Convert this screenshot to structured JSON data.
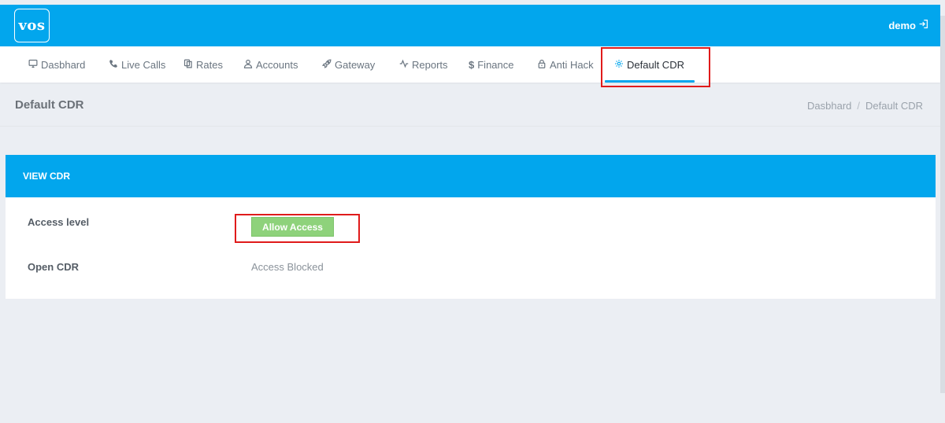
{
  "brand": {
    "logo_text": "vos"
  },
  "user": {
    "name": "demo"
  },
  "nav": {
    "items": [
      {
        "label": "Dasbhard",
        "icon": "monitor-icon"
      },
      {
        "label": "Live Calls",
        "icon": "phone-icon"
      },
      {
        "label": "Rates",
        "icon": "copy-icon"
      },
      {
        "label": "Accounts",
        "icon": "user-icon"
      },
      {
        "label": "Gateway",
        "icon": "rocket-icon"
      },
      {
        "label": "Reports",
        "icon": "activity-icon"
      },
      {
        "label": "Finance",
        "icon": "dollar-icon"
      },
      {
        "label": "Anti Hack",
        "icon": "lock-icon"
      },
      {
        "label": "Default CDR",
        "icon": "gear-icon",
        "active": true
      }
    ]
  },
  "page": {
    "title": "Default CDR",
    "breadcrumb": [
      "Dasbhard",
      "/",
      "Default CDR"
    ]
  },
  "card": {
    "title": "VIEW CDR",
    "rows": [
      {
        "label": "Access level",
        "button_label": "Allow Access"
      },
      {
        "label": "Open CDR",
        "value": "Access Blocked"
      }
    ]
  },
  "colors": {
    "primary": "#02a6ed",
    "success": "#8ed27b",
    "highlight": "#e01b1b",
    "background": "#ebeef3"
  }
}
